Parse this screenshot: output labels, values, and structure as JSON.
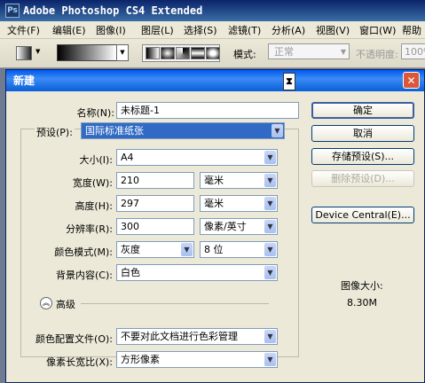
{
  "app": {
    "logo": "Ps",
    "title": "Adobe Photoshop CS4 Extended"
  },
  "menu": [
    "文件(F)",
    "编辑(E)",
    "图像(I)",
    "图层(L)",
    "选择(S)",
    "滤镜(T)",
    "分析(A)",
    "视图(V)",
    "窗口(W)",
    "帮助"
  ],
  "options": {
    "mode_label": "模式:",
    "mode_value": "正常",
    "opacity_label": "不透明度:",
    "opacity_value": "100%"
  },
  "dialog": {
    "title": "新建",
    "name_label": "名称(N):",
    "name_value": "未标题-1",
    "preset_label": "预设(P):",
    "preset_value": "国际标准纸张",
    "size_label": "大小(I):",
    "size_value": "A4",
    "width_label": "宽度(W):",
    "width_value": "210",
    "width_unit": "毫米",
    "height_label": "高度(H):",
    "height_value": "297",
    "height_unit": "毫米",
    "resolution_label": "分辨率(R):",
    "resolution_value": "300",
    "resolution_unit": "像素/英寸",
    "color_mode_label": "颜色模式(M):",
    "color_mode_value": "灰度",
    "bit_depth_value": "8 位",
    "background_label": "背景内容(C):",
    "background_value": "白色",
    "advanced_label": "高级",
    "color_profile_label": "颜色配置文件(O):",
    "color_profile_value": "不要对此文档进行色彩管理",
    "pixel_aspect_label": "像素长宽比(X):",
    "pixel_aspect_value": "方形像素",
    "buttons": {
      "ok": "确定",
      "cancel": "取消",
      "save_preset": "存储预设(S)...",
      "delete_preset": "删除预设(D)...",
      "device_central": "Device Central(E)..."
    },
    "image_size_label": "图像大小:",
    "image_size_value": "8.30M"
  },
  "colors": {
    "dialog_title_blue": "#0058ee",
    "close_red": "#d9573b",
    "selection_blue": "#316ac5"
  }
}
